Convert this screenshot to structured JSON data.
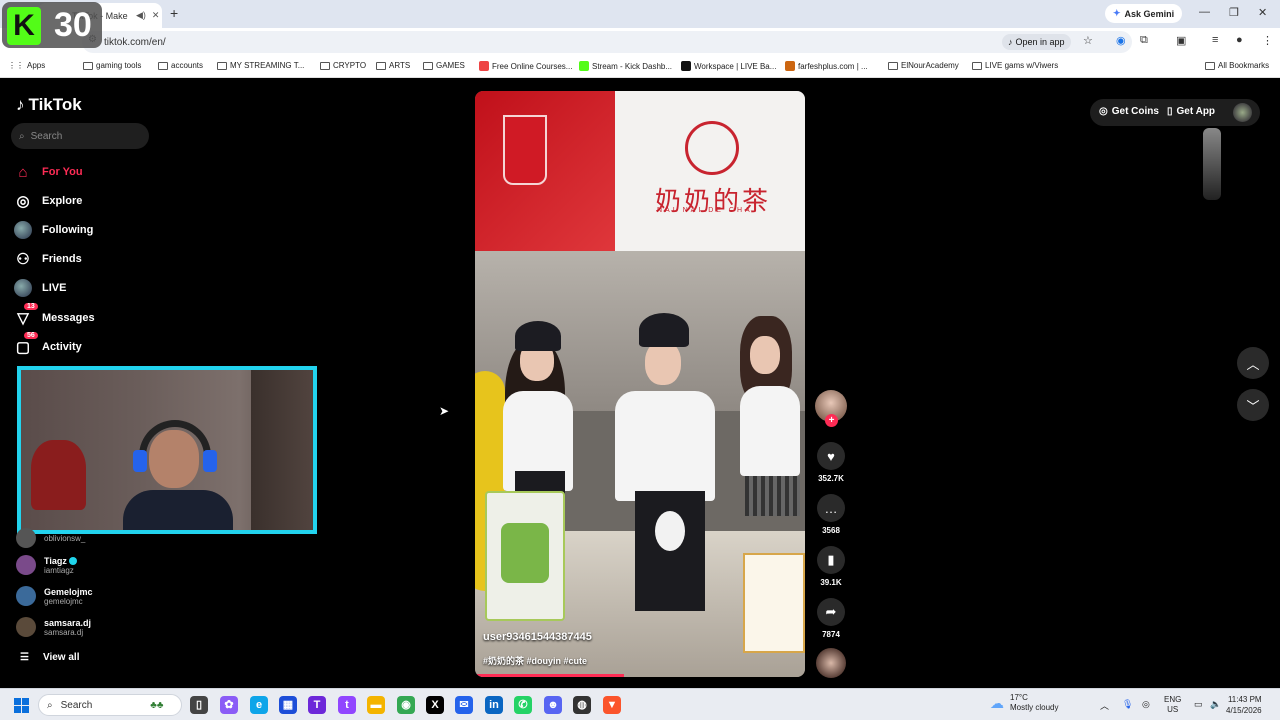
{
  "browser": {
    "tab_title": "TikTok - Make Your Day",
    "new_tab": "+",
    "ask_gemini": "Ask Gemini",
    "url": "tiktok.com/en/",
    "open_in_app": "Open in app"
  },
  "bookmarks": [
    {
      "label": "Apps",
      "type": "apps"
    },
    {
      "label": "gaming tools",
      "type": "folder"
    },
    {
      "label": "accounts",
      "type": "folder"
    },
    {
      "label": "MY STREAMING T...",
      "type": "folder"
    },
    {
      "label": "CRYPTO",
      "type": "folder"
    },
    {
      "label": "ARTS",
      "type": "folder"
    },
    {
      "label": "GAMES",
      "type": "folder"
    },
    {
      "label": "Free Online Courses...",
      "type": "site",
      "color": "#e44"
    },
    {
      "label": "Stream - Kick Dashb...",
      "type": "site",
      "color": "#53fc18"
    },
    {
      "label": "Workspace | LIVE Ba...",
      "type": "site",
      "color": "#111"
    },
    {
      "label": "farfeshplus.com | ...",
      "type": "site",
      "color": "#c61"
    },
    {
      "label": "ElNourAcademy",
      "type": "folder"
    },
    {
      "label": "LIVE gams w/Viwers",
      "type": "folder"
    },
    {
      "label": "All Bookmarks",
      "type": "folder"
    }
  ],
  "stream_overlay": {
    "k_letter": "K",
    "counter": "30"
  },
  "tiktok": {
    "brand": "TikTok",
    "search_placeholder": "Search",
    "nav": [
      {
        "label": "For You",
        "icon": "home-icon",
        "active": true
      },
      {
        "label": "Explore",
        "icon": "compass-icon"
      },
      {
        "label": "Following",
        "icon": "following-avatar"
      },
      {
        "label": "Friends",
        "icon": "friends-icon"
      },
      {
        "label": "LIVE",
        "icon": "live-avatar"
      },
      {
        "label": "Messages",
        "icon": "messages-icon",
        "badge": "13"
      },
      {
        "label": "Activity",
        "icon": "activity-icon",
        "badge": "56"
      }
    ],
    "following_accounts": [
      {
        "name": "",
        "username": "oblivionsw_"
      },
      {
        "name": "Tiagz",
        "username": "iamtiagz",
        "verified": true
      },
      {
        "name": "Gemelojmc",
        "username": "gemelojmc"
      },
      {
        "name": "samsara.dj",
        "username": "samsara.dj"
      }
    ],
    "view_all": "View all",
    "top_right": {
      "get_coins": "Get Coins",
      "get_app": "Get App"
    }
  },
  "video": {
    "sign_chinese": "奶奶的茶",
    "sign_pinyin": "NAI NAI DE CHA",
    "username": "user93461544387445",
    "hashtags": "#奶奶的茶 #douyin #cute",
    "progress": 0.45,
    "likes": "352.7K",
    "comments": "3568",
    "saves": "39.1K",
    "shares": "7874"
  },
  "taskbar": {
    "search": "Search",
    "weather_temp": "17°C",
    "weather_desc": "Mostly cloudy",
    "lang_top": "ENG",
    "lang_bottom": "US",
    "time": "11:43 PM",
    "date": "4/15/2026"
  }
}
